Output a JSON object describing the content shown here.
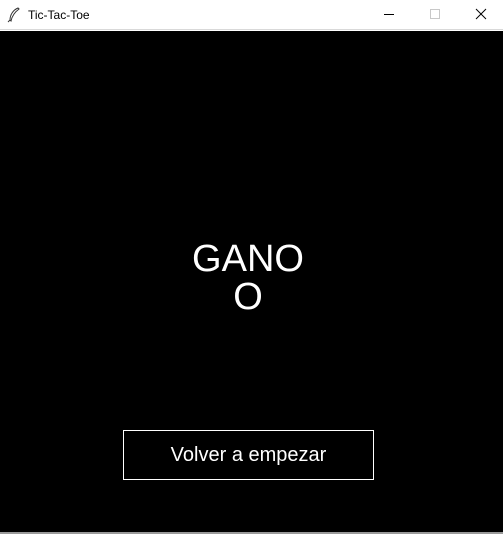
{
  "window": {
    "title": "Tic-Tac-Toe",
    "icon": "feather-icon",
    "controls": [
      "minimize-icon",
      "maximize-icon",
      "close-icon"
    ]
  },
  "game": {
    "status_line1": "GANO",
    "status_line2": "O",
    "restart_label": "Volver a empezar"
  },
  "colors": {
    "canvas_background": "#000000",
    "text": "#ffffff",
    "button_border": "#ffffff"
  }
}
